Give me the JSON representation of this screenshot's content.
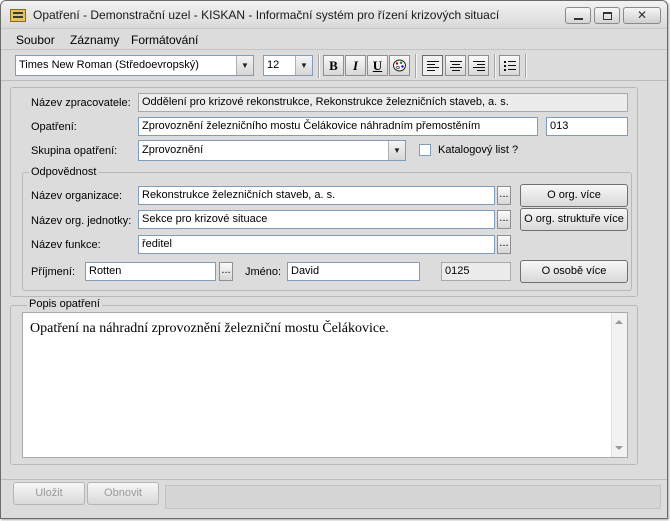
{
  "window": {
    "title": "Opatření - Demonstrační uzel - KISKAN - Informační systém pro řízení krizových situací",
    "close_glyph": "✕"
  },
  "menu": {
    "items": [
      "Soubor",
      "Záznamy",
      "Formátování"
    ]
  },
  "toolbar": {
    "font_family": "Times New Roman (Středoevropský)",
    "font_size": "12",
    "bold_label": "B",
    "italic_label": "I",
    "underline_label": "U",
    "dropdown_arrow": "▼"
  },
  "form": {
    "zpracovatel_label": "Název zpracovatele:",
    "zpracovatel_value": "Oddělení pro krizové rekonstrukce, Rekonstrukce železničních staveb, a. s.",
    "opatreni_label": "Opatření:",
    "opatreni_value": "Zprovoznění železničního mostu Čelákovice náhradním přemostěním",
    "opatreni_code": "013",
    "skupina_label": "Skupina opatření:",
    "skupina_value": "Zprovoznění",
    "katalog_label": "Katalogový list ?",
    "katalog_checked": false
  },
  "odpovednost": {
    "group_label": "Odpovědnost",
    "organizace_label": "Název organizace:",
    "organizace_value": "Rekonstrukce železničních staveb, a. s.",
    "jednotka_label": "Název org. jednotky:",
    "jednotka_value": "Sekce pro krizové situace",
    "funkce_label": "Název funkce:",
    "funkce_value": "ředitel",
    "prijmeni_label": "Příjmení:",
    "prijmeni_value": "Rotten",
    "jmeno_label": "Jméno:",
    "jmeno_value": "David",
    "osoba_code": "0125",
    "ellipsis": "...",
    "org_more_button": "O org. více",
    "struct_more_button": "O org. struktuře více",
    "person_more_button": "O osobě více"
  },
  "popis": {
    "group_label": "Popis opatření",
    "text": "Opatření na náhradní zprovoznění železniční mostu Čelákovice."
  },
  "footer": {
    "save_button": "Uložit",
    "refresh_button": "Obnovit"
  }
}
